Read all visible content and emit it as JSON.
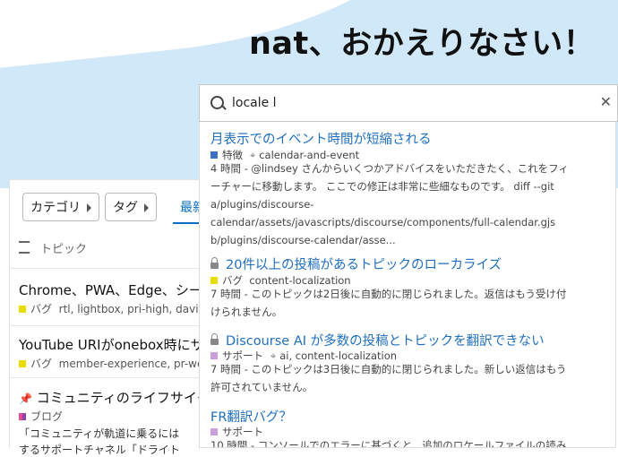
{
  "welcome": {
    "text": "nat、おかえりなさい！"
  },
  "nav": {
    "category_label": "カテゴリ",
    "tag_label": "タグ",
    "latest_tab": "最新",
    "topic_header": "トピック"
  },
  "topics": [
    {
      "title": "Chrome、PWA、Edge、シー",
      "category": "バグ",
      "category_color": "#e9dd00",
      "tags": "rtl, lightbox, pri-high,  david"
    },
    {
      "title": "YouTube URIがonebox時にサ",
      "category": "バグ",
      "category_color": "#e9dd00",
      "tags": "member-experience, pr-welc"
    },
    {
      "title": "コミュニティのライフサイク",
      "category": "ブログ",
      "category_color": "#8e44ad",
      "excerpt": "「コミュニティが軌道に乗るには",
      "excerpt2": "するサポートチャネル「ドライト"
    }
  ],
  "search": {
    "query": "locale l",
    "placeholder": "",
    "clear_icon": "close-icon"
  },
  "results": [
    {
      "title": "月表示でのイベント時間が短縮される",
      "locked": false,
      "category": "特徴",
      "category_color": "#3b6fc2",
      "tags": "calendar-and-event",
      "blurb": "4 時間 - @lindsey さんからいくつかアドバイスをいただきたく、これをフィーチャーに移動します。 ここでの修正は非常に些細なものです。 diff --git a/plugins/discourse-calendar/assets/javascripts/discourse/components/full-calendar.gjs b/plugins/discourse-calendar/asse..."
    },
    {
      "title": "20件以上の投稿があるトピックのローカライズ",
      "locked": true,
      "category": "バグ",
      "category_color": "#e9dd00",
      "tags": "content-localization",
      "blurb": "7 時間 - このトピックは2日後に自動的に閉じられました。返信はもう受け付けられません。"
    },
    {
      "title": "Discourse AI が多数の投稿とトピックを翻訳できない",
      "locked": true,
      "category": "サポート",
      "category_color": "#c9a0dc",
      "tags": "ai, content-localization",
      "blurb": "7 時間 - このトピックは3日後に自動的に閉じられました。新しい返信はもう許可されていません。"
    },
    {
      "title": "FR翻訳バグ？",
      "locked": false,
      "category": "サポート",
      "category_color": "#c9a0dc",
      "tags": "",
      "blurb": "10 時間 - コンソールでのエラーに基づくと、追加のロケールファイルの読み"
    }
  ]
}
